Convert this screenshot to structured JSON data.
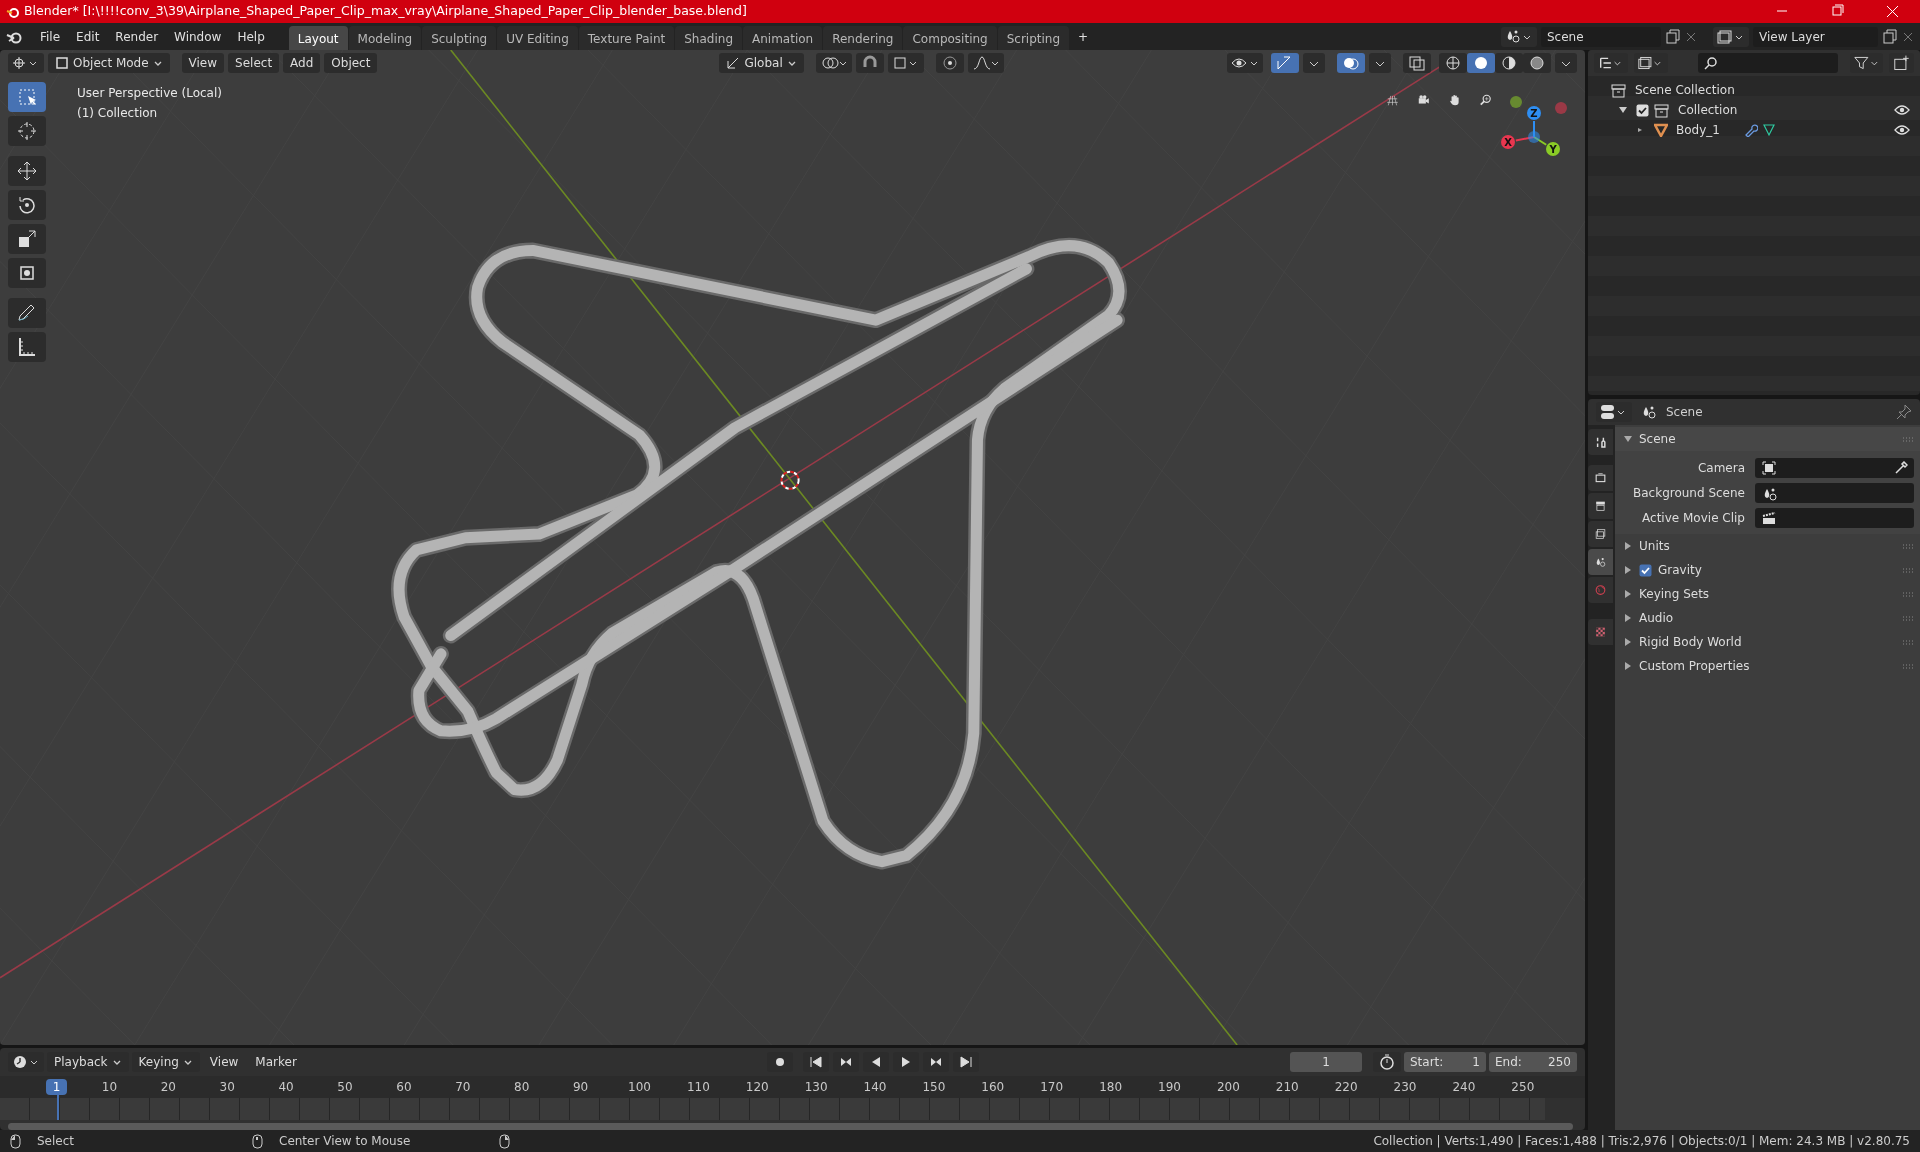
{
  "window": {
    "title": "Blender* [I:\\!!!!conv_3\\39\\Airplane_Shaped_Paper_Clip_max_vray\\Airplane_Shaped_Paper_Clip_blender_base.blend]"
  },
  "menu": [
    "File",
    "Edit",
    "Render",
    "Window",
    "Help"
  ],
  "workspaces": [
    {
      "label": "Layout",
      "selected": true
    },
    {
      "label": "Modeling",
      "selected": false
    },
    {
      "label": "Sculpting",
      "selected": false
    },
    {
      "label": "UV Editing",
      "selected": false
    },
    {
      "label": "Texture Paint",
      "selected": false
    },
    {
      "label": "Shading",
      "selected": false
    },
    {
      "label": "Animation",
      "selected": false
    },
    {
      "label": "Rendering",
      "selected": false
    },
    {
      "label": "Compositing",
      "selected": false
    },
    {
      "label": "Scripting",
      "selected": false
    }
  ],
  "add_workspace": "+",
  "scene": {
    "name": "Scene"
  },
  "view_layer": {
    "name": "View Layer"
  },
  "viewport": {
    "mode": "Object Mode",
    "menus": [
      "View",
      "Select",
      "Add",
      "Object"
    ],
    "orientation": "Global",
    "info": [
      "User Perspective (Local)",
      "(1) Collection"
    ],
    "tools": [
      {
        "selected": true
      },
      {
        "selected": false
      },
      {
        "selected": false
      },
      {
        "selected": false
      },
      {
        "selected": false
      },
      {
        "selected": false
      },
      {
        "selected": false
      },
      {
        "selected": false
      }
    ],
    "shading_modes": [
      {
        "selected": false
      },
      {
        "selected": true
      },
      {
        "selected": false
      },
      {
        "selected": false
      }
    ],
    "gizmo": [
      {
        "label": "X",
        "color": "#e8364f"
      },
      {
        "label": "Y",
        "color": "#8acb26"
      },
      {
        "label": "Z",
        "color": "#2e8ef2"
      }
    ]
  },
  "outliner": {
    "root": "Scene Collection",
    "items": [
      {
        "name": "Collection",
        "checked": true,
        "expanded": true,
        "children": [
          {
            "name": "Body_1"
          }
        ]
      }
    ]
  },
  "properties": {
    "context": "Scene",
    "tabs": [
      {
        "selected": false
      },
      {
        "selected": false
      },
      {
        "selected": false
      },
      {
        "selected": false
      },
      {
        "selected": true
      },
      {
        "selected": false
      },
      {
        "selected": false
      }
    ],
    "panels": [
      {
        "title": "Scene",
        "expanded": true,
        "fields": [
          {
            "label": "Camera",
            "kind": "object"
          },
          {
            "label": "Background Scene",
            "kind": "scene"
          },
          {
            "label": "Active Movie Clip",
            "kind": "clip"
          }
        ]
      },
      {
        "title": "Units",
        "expanded": false
      },
      {
        "title": "Gravity",
        "expanded": false,
        "checked": true
      },
      {
        "title": "Keying Sets",
        "expanded": false
      },
      {
        "title": "Audio",
        "expanded": false
      },
      {
        "title": "Rigid Body World",
        "expanded": false
      },
      {
        "title": "Custom Properties",
        "expanded": false
      }
    ]
  },
  "timeline": {
    "menus": [
      "Playback",
      "Keying",
      "View",
      "Marker"
    ],
    "current_frame": "1",
    "start_label": "Start:",
    "start": "1",
    "end_label": "End:",
    "end": "250",
    "ticks": [
      {
        "label": "1",
        "selected": true
      },
      {
        "label": "10",
        "selected": false
      },
      {
        "label": "20",
        "selected": false
      },
      {
        "label": "30",
        "selected": false
      },
      {
        "label": "40",
        "selected": false
      },
      {
        "label": "50",
        "selected": false
      },
      {
        "label": "60",
        "selected": false
      },
      {
        "label": "70",
        "selected": false
      },
      {
        "label": "80",
        "selected": false
      },
      {
        "label": "90",
        "selected": false
      },
      {
        "label": "100",
        "selected": false
      },
      {
        "label": "110",
        "selected": false
      },
      {
        "label": "120",
        "selected": false
      },
      {
        "label": "130",
        "selected": false
      },
      {
        "label": "140",
        "selected": false
      },
      {
        "label": "150",
        "selected": false
      },
      {
        "label": "160",
        "selected": false
      },
      {
        "label": "170",
        "selected": false
      },
      {
        "label": "180",
        "selected": false
      },
      {
        "label": "190",
        "selected": false
      },
      {
        "label": "200",
        "selected": false
      },
      {
        "label": "210",
        "selected": false
      },
      {
        "label": "220",
        "selected": false
      },
      {
        "label": "230",
        "selected": false
      },
      {
        "label": "240",
        "selected": false
      },
      {
        "label": "250",
        "selected": false
      }
    ]
  },
  "status_bar": {
    "hints": [
      "Select",
      "Center View to Mouse"
    ],
    "stats": "Collection | Verts:1,490 | Faces:1,488 | Tris:2,976 | Objects:0/1 | Mem: 24.3 MB | v2.80.75"
  }
}
